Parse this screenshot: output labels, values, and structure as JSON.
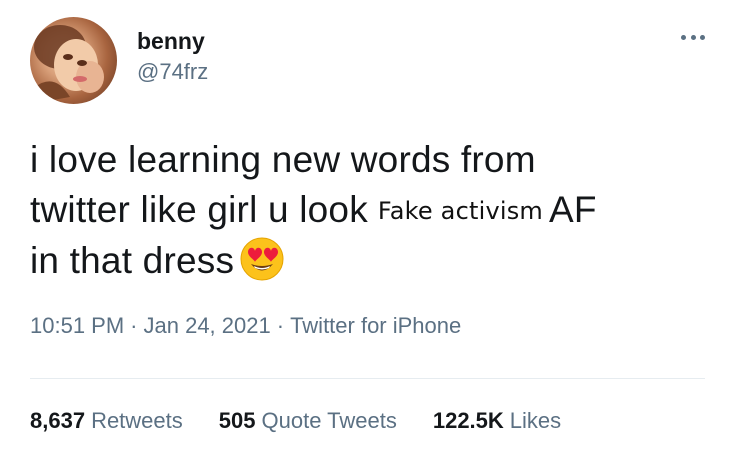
{
  "author": {
    "name": "benny",
    "handle": "@74frz"
  },
  "tweet": {
    "line1": "i love learning new words from",
    "line2_before": "twitter like girl u look",
    "overlay_word": "Fake activism",
    "line2_after": "AF",
    "line3": "in that dress",
    "emoji": "smiling-face-with-heart-eyes"
  },
  "meta": {
    "time": "10:51 PM",
    "date": "Jan 24, 2021",
    "source": "Twitter for iPhone",
    "separator": "·"
  },
  "stats": [
    {
      "count": "8,637",
      "label": "Retweets"
    },
    {
      "count": "505",
      "label": "Quote Tweets"
    },
    {
      "count": "122.5K",
      "label": "Likes"
    }
  ],
  "colors": {
    "text": "#14171a",
    "muted": "#5b7083",
    "divider": "#e6ecf0"
  }
}
